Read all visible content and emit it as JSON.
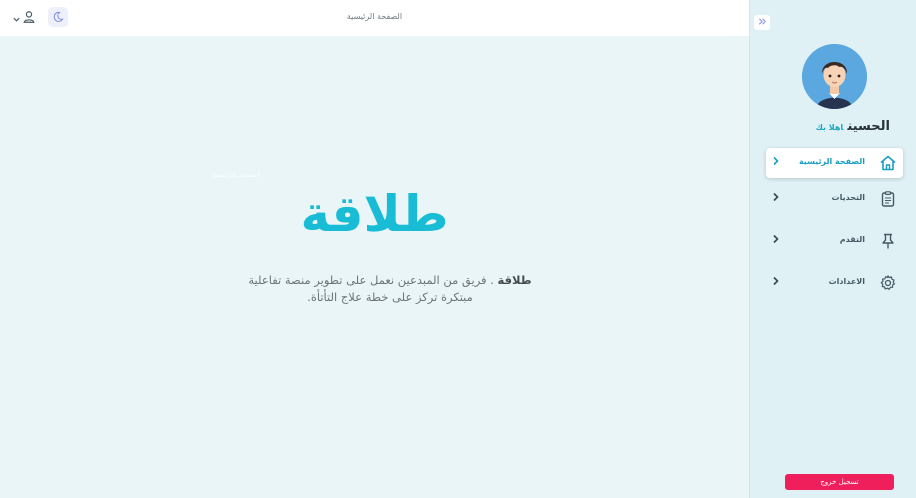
{
  "header": {
    "title": "الصفحة الرئيسية",
    "user_icon": "user-icon",
    "chevron_icon": "chevron-down-icon",
    "theme_icon": "moon-icon"
  },
  "main": {
    "brand": "طلاقة",
    "brand_faded": "الصفحة الرئيسية",
    "intro_brand": "طلاقة",
    "intro_text": " . فريق من المبدعين نعمل على تطوير منصة تفاعلية مبتكرة تركز على خطة علاج التأتأة."
  },
  "sidebar": {
    "collapse_icon": "double-chevron-icon",
    "hello": "اهلا بك",
    "user_name": "الحسين",
    "items": [
      {
        "label": "الصفحة الرئيسية",
        "icon": "home-icon",
        "active": true
      },
      {
        "label": "التحديات",
        "icon": "clipboard-icon",
        "active": false
      },
      {
        "label": "التقدم",
        "icon": "pin-icon",
        "active": false
      },
      {
        "label": "الاعدادات",
        "icon": "gear-icon",
        "active": false
      }
    ],
    "logout_label": "تسجيل خروج"
  },
  "colors": {
    "accent": "#18bcd4",
    "logout": "#ef1f5c",
    "sidebar_bg": "#dff1f5",
    "main_bg": "#eaf5f8"
  }
}
